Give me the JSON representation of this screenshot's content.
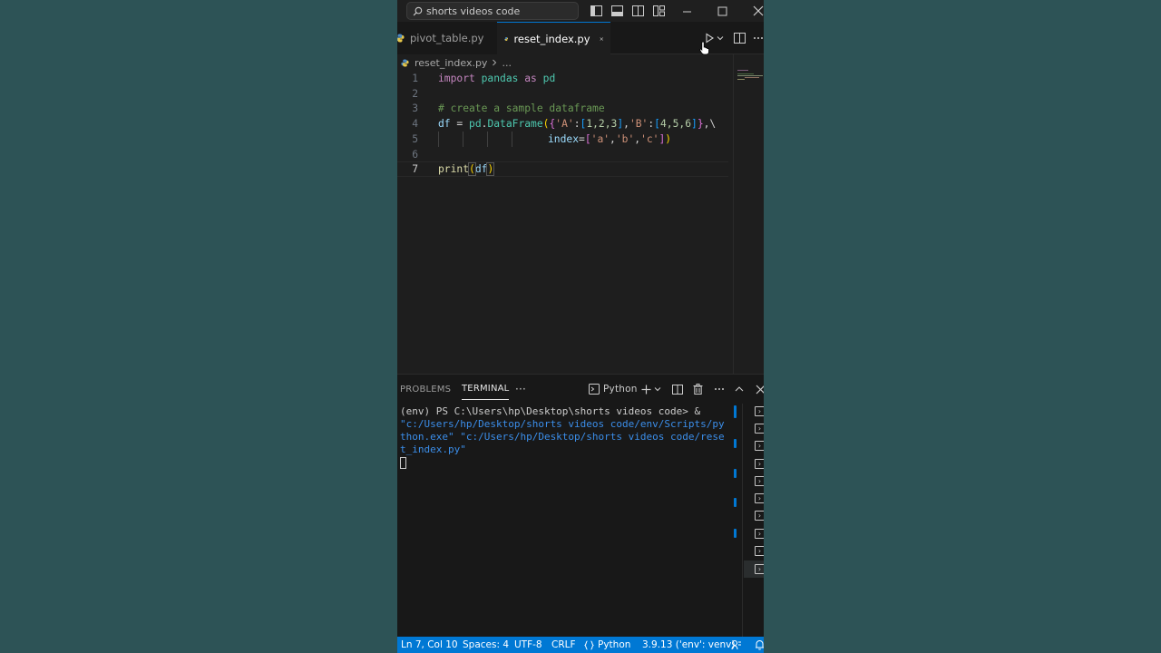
{
  "titlebar": {
    "search_text": "shorts videos code"
  },
  "tabs": [
    {
      "label": "pivot_table.py",
      "active": false
    },
    {
      "label": "reset_index.py",
      "active": true
    }
  ],
  "breadcrumb": {
    "file": "reset_index.py",
    "more": "..."
  },
  "editor": {
    "line_numbers": [
      "1",
      "2",
      "3",
      "4",
      "5",
      "6",
      "7"
    ],
    "line1": {
      "kw1": "import",
      "mod": "pandas",
      "kw2": "as",
      "alias": "pd"
    },
    "line3": {
      "comment": "# create a sample dataframe"
    },
    "line4": {
      "var": "df",
      "eq": " = ",
      "mod": "pd",
      "dot": ".",
      "cls": "DataFrame",
      "k1": "'A'",
      "v1": "1,2,3",
      "k2": "'B'",
      "v2": "4,5,6",
      "cont": ",\\"
    },
    "line5": {
      "kwarg": "index",
      "s1": "'a'",
      "s2": "'b'",
      "s3": "'c'"
    },
    "line7": {
      "fn": "print",
      "arg": "df"
    }
  },
  "panel": {
    "tab_problems": "PROBLEMS",
    "tab_terminal": "TERMINAL",
    "more": "···",
    "shell_label": "Python",
    "terminal_prompt": "(env) PS C:\\Users\\hp\\Desktop\\shorts videos code> & ",
    "terminal_cmd": "\"c:/Users/hp/Desktop/shorts videos code/env/Scripts/python.exe\" \"c:/Users/hp/Desktop/shorts videos code/reset_index.py\""
  },
  "statusbar": {
    "position": "Ln 7, Col 10",
    "spaces": "Spaces: 4",
    "encoding": "UTF-8",
    "eol": "CRLF",
    "language": "Python",
    "interpreter": "3.9.13 ('env': venv)"
  },
  "colors": {
    "accent": "#0078d4",
    "statusbar": "#0078d4",
    "background": "#2d5356"
  }
}
